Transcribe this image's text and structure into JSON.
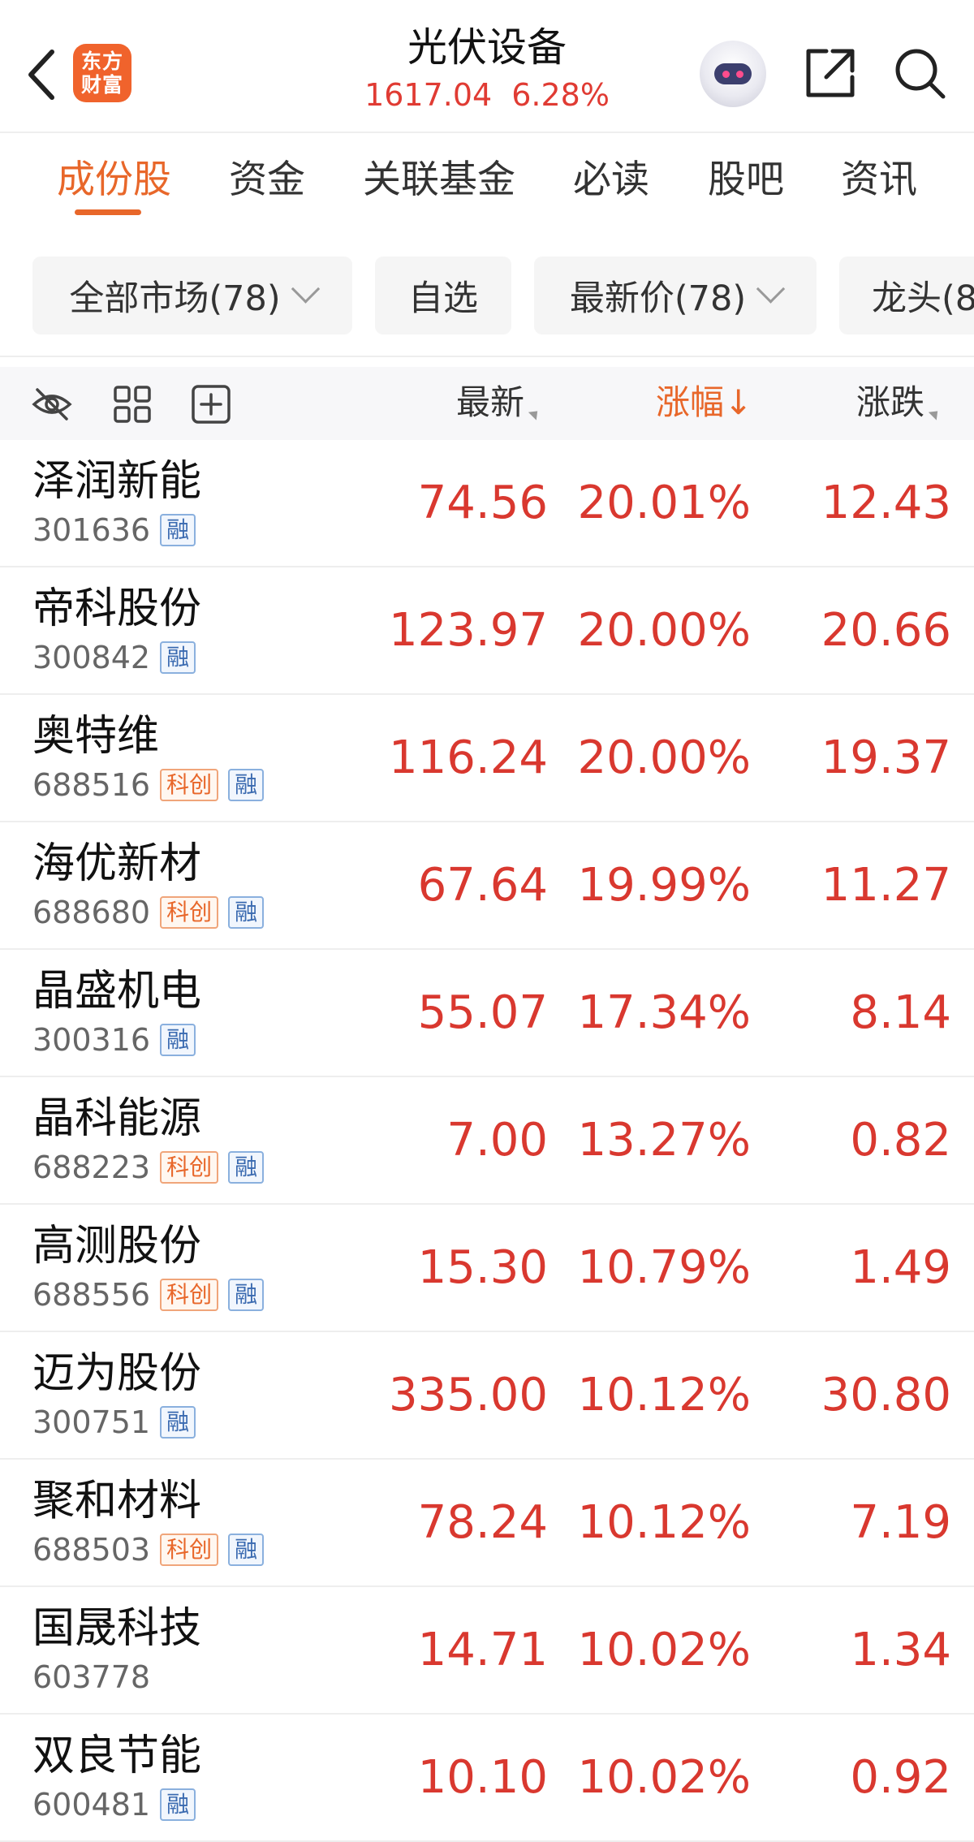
{
  "header": {
    "logo_line1": "东方",
    "logo_line2": "财富",
    "title": "光伏设备",
    "index_value": "1617.04",
    "index_change": "6.28%"
  },
  "tabs": [
    {
      "label": "成份股",
      "active": true
    },
    {
      "label": "资金"
    },
    {
      "label": "关联基金"
    },
    {
      "label": "必读"
    },
    {
      "label": "股吧"
    },
    {
      "label": "资讯"
    }
  ],
  "filters": [
    {
      "label": "全部市场(78)"
    },
    {
      "label": "自选"
    },
    {
      "label": "最新价(78)"
    },
    {
      "label": "龙头(8"
    }
  ],
  "table": {
    "headers": {
      "latest": "最新",
      "pct": "涨幅↓",
      "change": "涨跌"
    },
    "rows": [
      {
        "name": "泽润新能",
        "code": "301636",
        "kc": "",
        "rz": "融",
        "price": "74.56",
        "pct": "20.01%",
        "chg": "12.43"
      },
      {
        "name": "帝科股份",
        "code": "300842",
        "kc": "",
        "rz": "融",
        "price": "123.97",
        "pct": "20.00%",
        "chg": "20.66"
      },
      {
        "name": "奥特维",
        "code": "688516",
        "kc": "科创",
        "rz": "融",
        "price": "116.24",
        "pct": "20.00%",
        "chg": "19.37"
      },
      {
        "name": "海优新材",
        "code": "688680",
        "kc": "科创",
        "rz": "融",
        "price": "67.64",
        "pct": "19.99%",
        "chg": "11.27"
      },
      {
        "name": "晶盛机电",
        "code": "300316",
        "kc": "",
        "rz": "融",
        "price": "55.07",
        "pct": "17.34%",
        "chg": "8.14"
      },
      {
        "name": "晶科能源",
        "code": "688223",
        "kc": "科创",
        "rz": "融",
        "price": "7.00",
        "pct": "13.27%",
        "chg": "0.82"
      },
      {
        "name": "高测股份",
        "code": "688556",
        "kc": "科创",
        "rz": "融",
        "price": "15.30",
        "pct": "10.79%",
        "chg": "1.49"
      },
      {
        "name": "迈为股份",
        "code": "300751",
        "kc": "",
        "rz": "融",
        "price": "335.00",
        "pct": "10.12%",
        "chg": "30.80"
      },
      {
        "name": "聚和材料",
        "code": "688503",
        "kc": "科创",
        "rz": "融",
        "price": "78.24",
        "pct": "10.12%",
        "chg": "7.19"
      },
      {
        "name": "国晟科技",
        "code": "603778",
        "kc": "",
        "rz": "",
        "price": "14.71",
        "pct": "10.02%",
        "chg": "1.34"
      },
      {
        "name": "双良节能",
        "code": "600481",
        "kc": "",
        "rz": "融",
        "price": "10.10",
        "pct": "10.02%",
        "chg": "0.92"
      }
    ]
  },
  "colors": {
    "accent": "#e8672a",
    "up": "#d9382f",
    "logo": "#f0632c"
  },
  "icons": [
    "back-arrow-icon",
    "robot-assistant-icon",
    "share-icon",
    "search-icon",
    "hide-eye-icon",
    "grid-icon",
    "add-square-icon",
    "chevron-down-icon"
  ]
}
